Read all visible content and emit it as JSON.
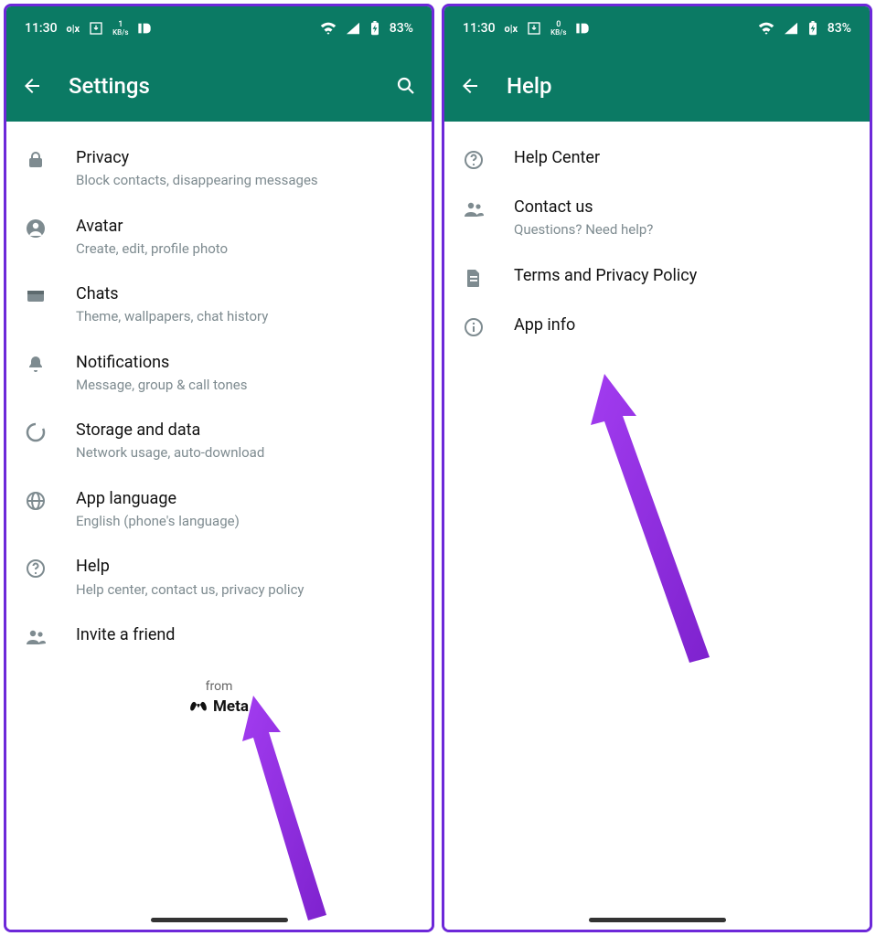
{
  "statusbar": {
    "time": "11:30",
    "kb_value": "1",
    "kb_unit": "KB/s",
    "kb_value2": "0",
    "battery": "83%"
  },
  "left": {
    "title": "Settings",
    "items": [
      {
        "icon": "lock-icon",
        "label": "Privacy",
        "sub": "Block contacts, disappearing messages"
      },
      {
        "icon": "avatar-icon",
        "label": "Avatar",
        "sub": "Create, edit, profile photo"
      },
      {
        "icon": "chats-icon",
        "label": "Chats",
        "sub": "Theme, wallpapers, chat history"
      },
      {
        "icon": "bell-icon",
        "label": "Notifications",
        "sub": "Message, group & call tones"
      },
      {
        "icon": "storage-icon",
        "label": "Storage and data",
        "sub": "Network usage, auto-download"
      },
      {
        "icon": "globe-icon",
        "label": "App language",
        "sub": "English (phone's language)"
      },
      {
        "icon": "help-icon",
        "label": "Help",
        "sub": "Help center, contact us, privacy policy"
      },
      {
        "icon": "people-icon",
        "label": "Invite a friend",
        "sub": ""
      }
    ],
    "footer_from": "from",
    "footer_brand": "Meta"
  },
  "right": {
    "title": "Help",
    "items": [
      {
        "icon": "help-icon",
        "label": "Help Center",
        "sub": ""
      },
      {
        "icon": "people-icon",
        "label": "Contact us",
        "sub": "Questions? Need help?"
      },
      {
        "icon": "doc-icon",
        "label": "Terms and Privacy Policy",
        "sub": ""
      },
      {
        "icon": "info-icon",
        "label": "App info",
        "sub": ""
      }
    ]
  }
}
